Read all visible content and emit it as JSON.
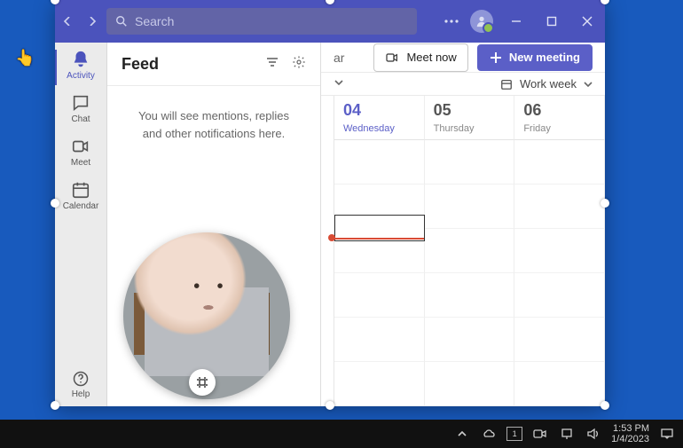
{
  "titlebar": {
    "search_placeholder": "Search"
  },
  "rail": {
    "activity": "Activity",
    "chat": "Chat",
    "meet": "Meet",
    "calendar": "Calendar",
    "help": "Help"
  },
  "feed": {
    "title": "Feed",
    "empty_line1": "You will see mentions, replies",
    "empty_line2": "and other notifications here."
  },
  "calendar": {
    "meet_now": "Meet now",
    "new_meeting": "New meeting",
    "view_label": "Work week",
    "truncated_header": "ar",
    "days": [
      {
        "num": "04",
        "name": "Wednesday",
        "today": true
      },
      {
        "num": "05",
        "name": "Thursday",
        "today": false
      },
      {
        "num": "06",
        "name": "Friday",
        "today": false
      }
    ]
  },
  "taskbar": {
    "time": "1:53 PM",
    "date": "1/4/2023"
  }
}
